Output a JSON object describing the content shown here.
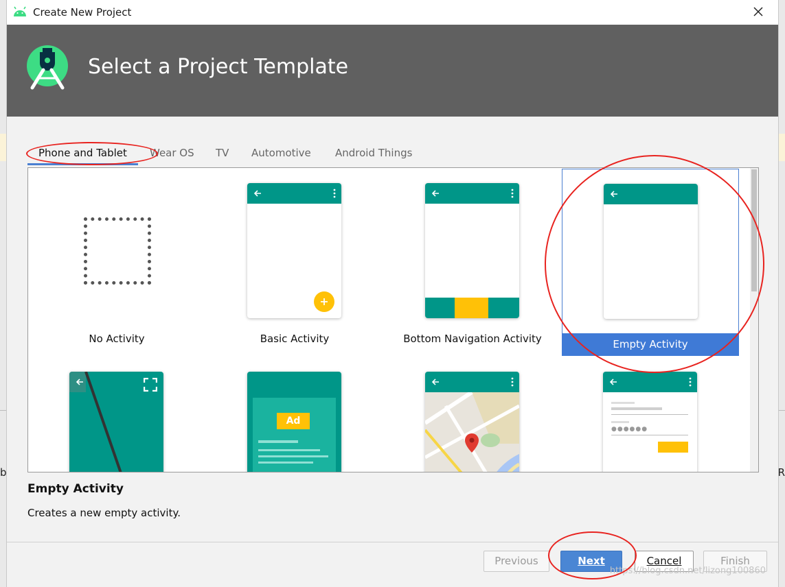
{
  "window": {
    "title": "Create New Project"
  },
  "header": {
    "title": "Select a Project Template"
  },
  "tabs": [
    {
      "label": "Phone and Tablet"
    },
    {
      "label": "Wear OS"
    },
    {
      "label": "TV"
    },
    {
      "label": "Automotive"
    },
    {
      "label": "Android Things"
    }
  ],
  "templates": [
    {
      "label": "No Activity"
    },
    {
      "label": "Basic Activity"
    },
    {
      "label": "Bottom Navigation Activity"
    },
    {
      "label": "Empty Activity",
      "selected": true
    },
    {
      "label": ""
    },
    {
      "label": ""
    },
    {
      "label": ""
    },
    {
      "label": ""
    }
  ],
  "ad_badge": "Ad",
  "description": {
    "title": "Empty Activity",
    "text": "Creates a new empty activity."
  },
  "buttons": {
    "previous": "Previous",
    "next": "Next",
    "cancel": "Cancel",
    "finish": "Finish"
  },
  "watermark": "https://blog.csdn.net/lizong100860",
  "colors": {
    "accent": "#3f7ad6",
    "teal": "#009688",
    "fab": "#ffc107",
    "header": "#606060",
    "annotation": "#e8231f"
  }
}
